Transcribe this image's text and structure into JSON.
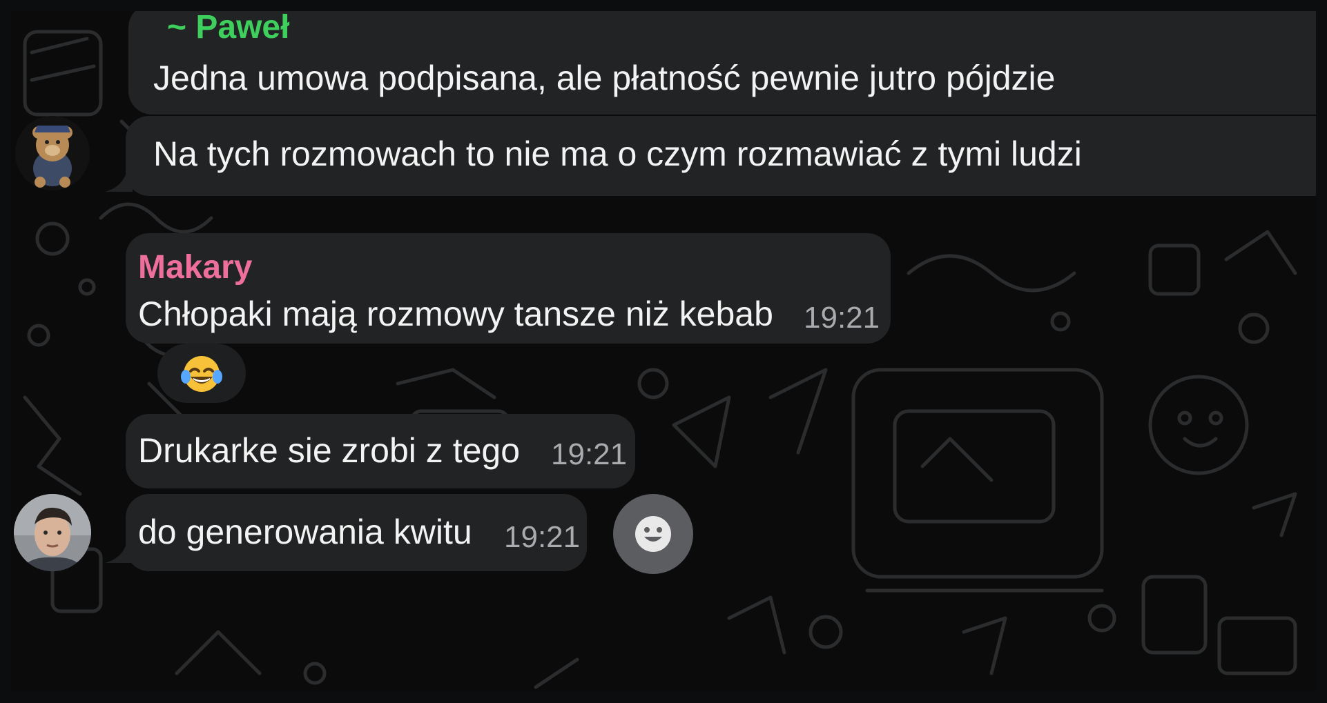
{
  "colors": {
    "background": "#0b0b0b",
    "bubble": "#222324",
    "text": "#f3f3f3",
    "timestamp": "#a9abae",
    "sender_pawel": "#3fcf5d",
    "sender_makary": "#ee6f9c"
  },
  "messages": [
    {
      "sender": "~ Paweł",
      "text": "Jedna umowa podpisana, ale płatność pewnie jutro pójdzie"
    },
    {
      "text": "Na tych rozmowach to nie ma o czym rozmawiać z tymi ludzi",
      "avatar_icon": "teddy-bear-avatar-icon"
    },
    {
      "sender": "Makary",
      "text": "Chłopaki mają rozmowy tansze niż kebab",
      "time": "19:21",
      "reaction": {
        "emoji": "😂",
        "icon": "face-with-tears-of-joy-icon"
      }
    },
    {
      "text": "Drukarke sie zrobi z tego",
      "time": "19:21"
    },
    {
      "text": "do generowania kwitu",
      "time": "19:21",
      "avatar_icon": "man-photo-avatar-icon"
    }
  ],
  "emoji_button": {
    "icon": "smiley-face-icon"
  }
}
